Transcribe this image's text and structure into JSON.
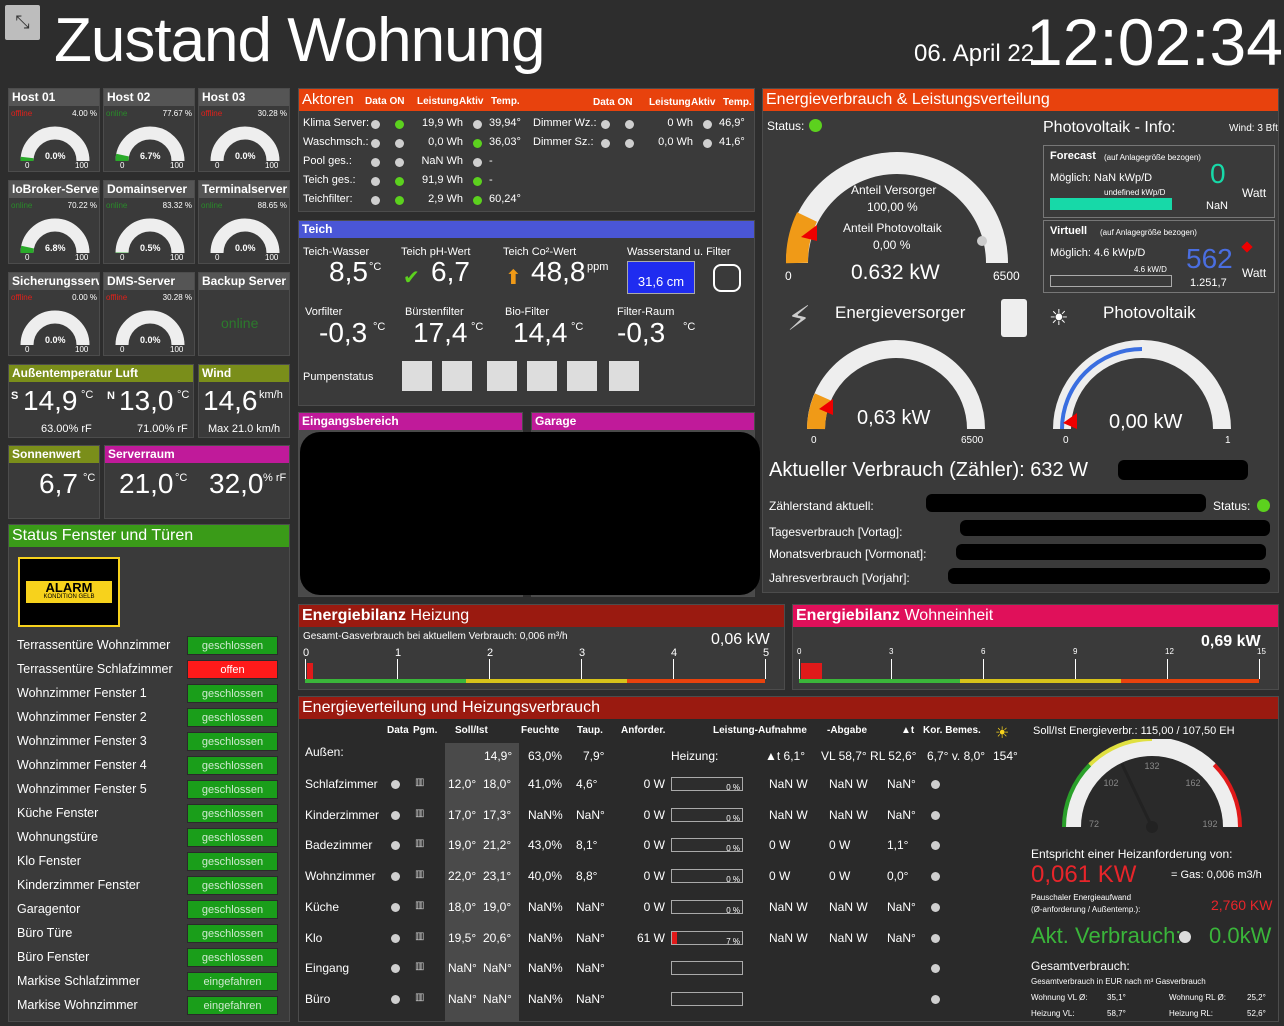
{
  "header": {
    "title": "Zustand Wohnung",
    "date": "06. April 22",
    "time": "12:02:34"
  },
  "hosts": [
    {
      "name": "Host 01",
      "status": "offline",
      "pct": "4.00 %",
      "val": "0.0%",
      "fill": 0.04,
      "min": "0",
      "max": "100"
    },
    {
      "name": "Host 02",
      "status": "online",
      "pct": "77.67 %",
      "val": "6.7%",
      "fill": 0.067,
      "min": "0",
      "max": "100"
    },
    {
      "name": "Host 03",
      "status": "offline",
      "pct": "30.28 %",
      "val": "0.0%",
      "fill": 0,
      "min": "0",
      "max": "100"
    },
    {
      "name": "IoBroker-Server",
      "status": "online",
      "pct": "70.22 %",
      "val": "6.8%",
      "fill": 0.068,
      "min": "0",
      "max": "100"
    },
    {
      "name": "Domainserver",
      "status": "online",
      "pct": "83.32 %",
      "val": "0.5%",
      "fill": 0.005,
      "min": "0",
      "max": "100"
    },
    {
      "name": "Terminalserver",
      "status": "online",
      "pct": "88.65 %",
      "val": "0.0%",
      "fill": 0,
      "min": "0",
      "max": "100"
    },
    {
      "name": "Sicherungsserver",
      "status": "offline",
      "pct": "0.00 %",
      "val": "0.0%",
      "fill": 0,
      "min": "0",
      "max": "100"
    },
    {
      "name": "DMS-Server",
      "status": "offline",
      "pct": "30.28 %",
      "val": "0.0%",
      "fill": 0,
      "min": "0",
      "max": "100"
    }
  ],
  "backup": {
    "name": "Backup Server",
    "status": "online"
  },
  "aussen": {
    "title": "Außentemperatur Luft",
    "s": "S",
    "s_val": "14,9",
    "s_unit": "°C",
    "s_rf": "63.00% rF",
    "n": "N",
    "n_val": "13,0",
    "n_unit": "°C",
    "n_rf": "71.00% rF"
  },
  "wind": {
    "title": "Wind",
    "val": "14,6",
    "unit": "km/h",
    "max": "Max 21.0 km/h"
  },
  "sonne": {
    "title": "Sonnenwert",
    "val": "6,7",
    "unit": "°C"
  },
  "server": {
    "title": "Serverraum",
    "temp": "21,0",
    "temp_unit": "°C",
    "hum": "32,0",
    "hum_unit": "% rF"
  },
  "fenster": {
    "title": "Status Fenster und Türen",
    "alarm_title": "ALARM",
    "alarm_sub": "KONDITION GELB",
    "items": [
      {
        "name": "Terrassentüre Wohnzimmer",
        "state": "geschlossen",
        "ok": true
      },
      {
        "name": "Terrassentüre Schlafzimmer",
        "state": "offen",
        "ok": false
      },
      {
        "name": "Wohnzimmer Fenster 1",
        "state": "geschlossen",
        "ok": true
      },
      {
        "name": "Wohnzimmer Fenster 2",
        "state": "geschlossen",
        "ok": true
      },
      {
        "name": "Wohnzimmer Fenster 3",
        "state": "geschlossen",
        "ok": true
      },
      {
        "name": "Wohnzimmer Fenster 4",
        "state": "geschlossen",
        "ok": true
      },
      {
        "name": "Wohnzimmer Fenster 5",
        "state": "geschlossen",
        "ok": true
      },
      {
        "name": "Küche Fenster",
        "state": "geschlossen",
        "ok": true
      },
      {
        "name": "Wohnungstüre",
        "state": "geschlossen",
        "ok": true
      },
      {
        "name": "Klo Fenster",
        "state": "geschlossen",
        "ok": true
      },
      {
        "name": "Kinderzimmer Fenster",
        "state": "geschlossen",
        "ok": true
      },
      {
        "name": "Garagentor",
        "state": "geschlossen",
        "ok": true
      },
      {
        "name": "Büro Türe",
        "state": "geschlossen",
        "ok": true
      },
      {
        "name": "Büro Fenster",
        "state": "geschlossen",
        "ok": true
      },
      {
        "name": "Markise Schlafzimmer",
        "state": "eingefahren",
        "ok": true
      },
      {
        "name": "Markise Wohnzimmer",
        "state": "eingefahren",
        "ok": true
      }
    ]
  },
  "aktoren": {
    "title": "Aktoren",
    "h_data": "Data ON",
    "h_leistung": "Leistung",
    "h_aktiv": "Aktiv",
    "h_temp": "Temp.",
    "left": [
      {
        "name": "Klima Server:",
        "d": "off",
        "o": "on",
        "w": "19,9 Wh",
        "a": "off",
        "t": "39,94°"
      },
      {
        "name": "Waschmsch.:",
        "d": "off",
        "o": "off",
        "w": "0,0 Wh",
        "a": "on",
        "t": "36,03°"
      },
      {
        "name": "Pool ges.:",
        "d": "off",
        "o": "off",
        "w": "NaN Wh",
        "a": "off",
        "t": "-"
      },
      {
        "name": "Teich ges.:",
        "d": "off",
        "o": "on",
        "w": "91,9 Wh",
        "a": "on",
        "t": "-"
      },
      {
        "name": "Teichfilter:",
        "d": "off",
        "o": "on",
        "w": "2,9 Wh",
        "a": "on",
        "t": "60,24°"
      }
    ],
    "right": [
      {
        "name": "Dimmer Wz.:",
        "d": "off",
        "o": "off",
        "w": "0 Wh",
        "a": "off",
        "t": "46,9°"
      },
      {
        "name": "Dimmer Sz.:",
        "d": "off",
        "o": "off",
        "w": "0,0 Wh",
        "a": "off",
        "t": "41,6°"
      }
    ]
  },
  "teich": {
    "title": "Teich",
    "wasser_l": "Teich-Wasser",
    "wasser": "8,5",
    "wasser_u": "°C",
    "ph_l": "Teich pH-Wert",
    "ph": "6,7",
    "co2_l": "Teich Co²-Wert",
    "co2": "48,8",
    "co2_u": "ppm",
    "stand_l": "Wasserstand u. Filter",
    "stand": "31,6 cm",
    "vor_l": "Vorfilter",
    "vor": "-0,3",
    "vor_u": "°C",
    "buer_l": "Bürstenfilter",
    "buer": "17,4",
    "buer_u": "°C",
    "bio_l": "Bio-Filter",
    "bio": "14,4",
    "bio_u": "°C",
    "raum_l": "Filter-Raum",
    "raum": "-0,3",
    "raum_u": "°C",
    "pumpen": "Pumpenstatus"
  },
  "cams": {
    "eingang": "Eingangsbereich",
    "garage": "Garage"
  },
  "energie": {
    "title": "Energieverbrauch & Leistungsverteilung",
    "status": "Status:",
    "anteil_v_l": "Anteil Versorger",
    "anteil_v": "100,00 %",
    "anteil_p_l": "Anteil Photovoltaik",
    "anteil_p": "0,00 %",
    "main": "0.632 kW",
    "main_min": "0",
    "main_max": "6500",
    "pv_title": "Photovoltaik - Info:",
    "wind": "Wind: 3 Bft",
    "fc_title": "Forecast",
    "fc_sub": "(auf Anlagegröße bezogen)",
    "fc_moeglich": "Möglich: NaN kWp/D",
    "fc_undef": "undefined kWp/D",
    "fc_val": "0",
    "fc_nan": "NaN",
    "fc_watt": "Watt",
    "vi_title": "Virtuell",
    "vi_sub": "(auf Anlagegröße bezogen)",
    "vi_moeglich": "Möglich: 4.6 kWp/D",
    "vi_kwh": "4.6 kW/D",
    "vi_val": "562",
    "vi_sub2": "1.251,7",
    "vi_watt": "Watt",
    "ev_title": "Energieversorger",
    "ev_val": "0,63 kW",
    "ev_min": "0",
    "ev_max": "6500",
    "pv2_title": "Photovoltaik",
    "pv_val": "0,00 kW",
    "pv_min": "0",
    "pv_max": "1",
    "aktuell": "Aktueller Verbrauch (Zähler): 632 W",
    "zs": "Zählerstand aktuell:",
    "status2": "Status:",
    "tv": "Tagesverbrauch [Vortag]:",
    "mv": "Monatsverbrauch [Vormonat]:",
    "jv": "Jahresverbrauch [Vorjahr]:"
  },
  "bilanz_h": {
    "title_b": "Energiebilanz",
    "title": "Heizung",
    "sub": "Gesamt-Gasverbrauch bei aktuellem Verbrauch: 0,006 m³/h",
    "val": "0,06 kW",
    "ticks": [
      "0",
      "1",
      "2",
      "3",
      "4",
      "5"
    ],
    "fill": 0.012
  },
  "bilanz_w": {
    "title_b": "Energiebilanz",
    "title": "Wohneinheit",
    "val": "0,69 kW",
    "ticks": [
      "0",
      "3",
      "6",
      "9",
      "12",
      "15"
    ],
    "fill": 0.046
  },
  "heiz": {
    "title": "Energieverteilung und Heizungsverbrauch",
    "h": [
      "Data",
      "Pgm.",
      "Soll/Ist",
      "Feuchte",
      "Taup.",
      "Anforder.",
      "Leistung-Aufnahme",
      "-Abgabe",
      "▲t",
      "Kor. Bemes."
    ],
    "aussen": {
      "name": "Außen:",
      "ist": "14,9°",
      "f": "63,0%",
      "t": "7,9°",
      "heizung": "Heizung:",
      "dt": "▲t 6,1°",
      "vl": "VL 58,7° RL 52,6°",
      "kor": "6,7° v. 8,0°",
      "deg": "154°"
    },
    "rooms": [
      {
        "name": "Schlafzimmer",
        "soll": "12,0°",
        "ist": "18,0°",
        "f": "41,0%",
        "t": "4,6°",
        "w": "0 W",
        "bar": "0 %",
        "bf": 0,
        "a": "NaN W",
        "b": "NaN W",
        "c": "NaN°"
      },
      {
        "name": "Kinderzimmer",
        "soll": "17,0°",
        "ist": "17,3°",
        "f": "NaN%",
        "t": "NaN°",
        "w": "0 W",
        "bar": "0 %",
        "bf": 0,
        "a": "NaN W",
        "b": "NaN W",
        "c": "NaN°"
      },
      {
        "name": "Badezimmer",
        "soll": "19,0°",
        "ist": "21,2°",
        "f": "43,0%",
        "t": "8,1°",
        "w": "0 W",
        "bar": "0 %",
        "bf": 0,
        "a": "0 W",
        "b": "0 W",
        "c": "1,1°"
      },
      {
        "name": "Wohnzimmer",
        "soll": "22,0°",
        "ist": "23,1°",
        "f": "40,0%",
        "t": "8,8°",
        "w": "0 W",
        "bar": "0 %",
        "bf": 0,
        "a": "0 W",
        "b": "0 W",
        "c": "0,0°"
      },
      {
        "name": "Küche",
        "soll": "18,0°",
        "ist": "19,0°",
        "f": "NaN%",
        "t": "NaN°",
        "w": "0 W",
        "bar": "0 %",
        "bf": 0,
        "a": "NaN W",
        "b": "NaN W",
        "c": "NaN°"
      },
      {
        "name": "Klo",
        "soll": "19,5°",
        "ist": "20,6°",
        "f": "NaN%",
        "t": "NaN°",
        "w": "61 W",
        "bar": "7 %",
        "bf": 0.07,
        "a": "NaN W",
        "b": "NaN W",
        "c": "NaN°"
      },
      {
        "name": "Eingang",
        "soll": "NaN°",
        "ist": "NaN°",
        "f": "NaN%",
        "t": "NaN°",
        "w": "",
        "bar": "",
        "bf": 0,
        "a": "",
        "b": "",
        "c": ""
      },
      {
        "name": "Büro",
        "soll": "NaN°",
        "ist": "NaN°",
        "f": "NaN%",
        "t": "NaN°",
        "w": "",
        "bar": "",
        "bf": 0,
        "a": "",
        "b": "",
        "c": ""
      }
    ],
    "soll_ist": "Soll/Ist Energieverbr.: 115,00 / 107,50 EH",
    "g_ticks": [
      "72",
      "102",
      "132",
      "162",
      "192"
    ],
    "g_value": 115,
    "entspricht": "Entspricht einer Heizanforderung von:",
    "kw": "0,061 KW",
    "gas": "= Gas: 0,006 m3/h",
    "pausch": "Pauschaler Energieaufwand",
    "pausch2": "(Ø-anforderung / Außentemp.):",
    "pausch_val": "2,760 KW",
    "akt": "Akt. Verbrauch:",
    "akt_val": "0.0kW",
    "ges": "Gesamtverbrauch:",
    "ges_sub": "Gesamtverbrauch in EUR nach m³ Gasverbrauch",
    "wvl": "Wohnung VL Ø:",
    "wvl_v": "35,1°",
    "wrl": "Wohnung RL Ø:",
    "wrl_v": "25,2°",
    "hvl": "Heizung VL:",
    "hvl_v": "58,7°",
    "hrl": "Heizung RL:",
    "hrl_v": "52,6°"
  },
  "colors": {
    "green": "#5cd11e",
    "red": "#e8420d",
    "gauge_orange": "#f09a17",
    "gauge_blue": "#3a6ee0"
  }
}
